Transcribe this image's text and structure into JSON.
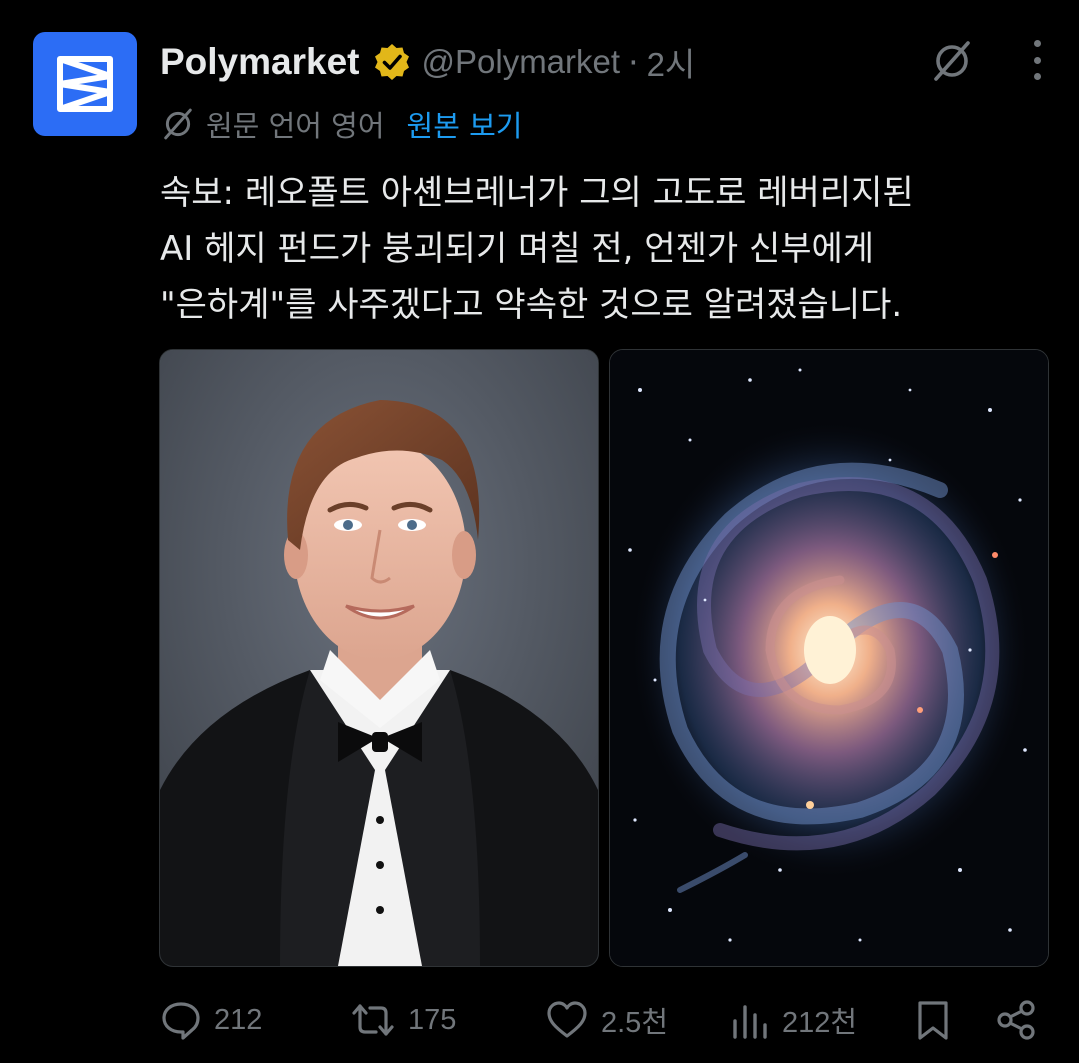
{
  "author": {
    "name": "Polymarket",
    "handle": "@Polymarket",
    "separator": "·",
    "time": "2시",
    "avatar_icon": "polymarket-logo-icon",
    "verified_icon": "gold-verified-badge-icon",
    "avatar_color": "#2c6df5",
    "verified_color": "#e2b719"
  },
  "translation": {
    "icon": "grok-icon",
    "label": "원문 언어 영어",
    "link": "원본 보기",
    "link_color": "#1d9bf0"
  },
  "tweet": {
    "lines": [
      "속보: 레오폴트 아셴브레너가 그의 고도로 레버리지된",
      "AI 헤지 펀드가 붕괴되기 며칠 전, 언젠가 신부에게",
      "\"은하계\"를 사주겠다고 약속한 것으로 알려졌습니다."
    ]
  },
  "media": [
    {
      "icon": "portrait-photo"
    },
    {
      "icon": "spiral-galaxy-photo"
    }
  ],
  "actions": {
    "reply_count": "212",
    "retweet_count": "175",
    "like_count": "2.5천",
    "view_count": "212천",
    "icons": [
      "reply-icon",
      "retweet-icon",
      "like-icon",
      "views-icon",
      "bookmark-icon",
      "share-icon"
    ]
  }
}
